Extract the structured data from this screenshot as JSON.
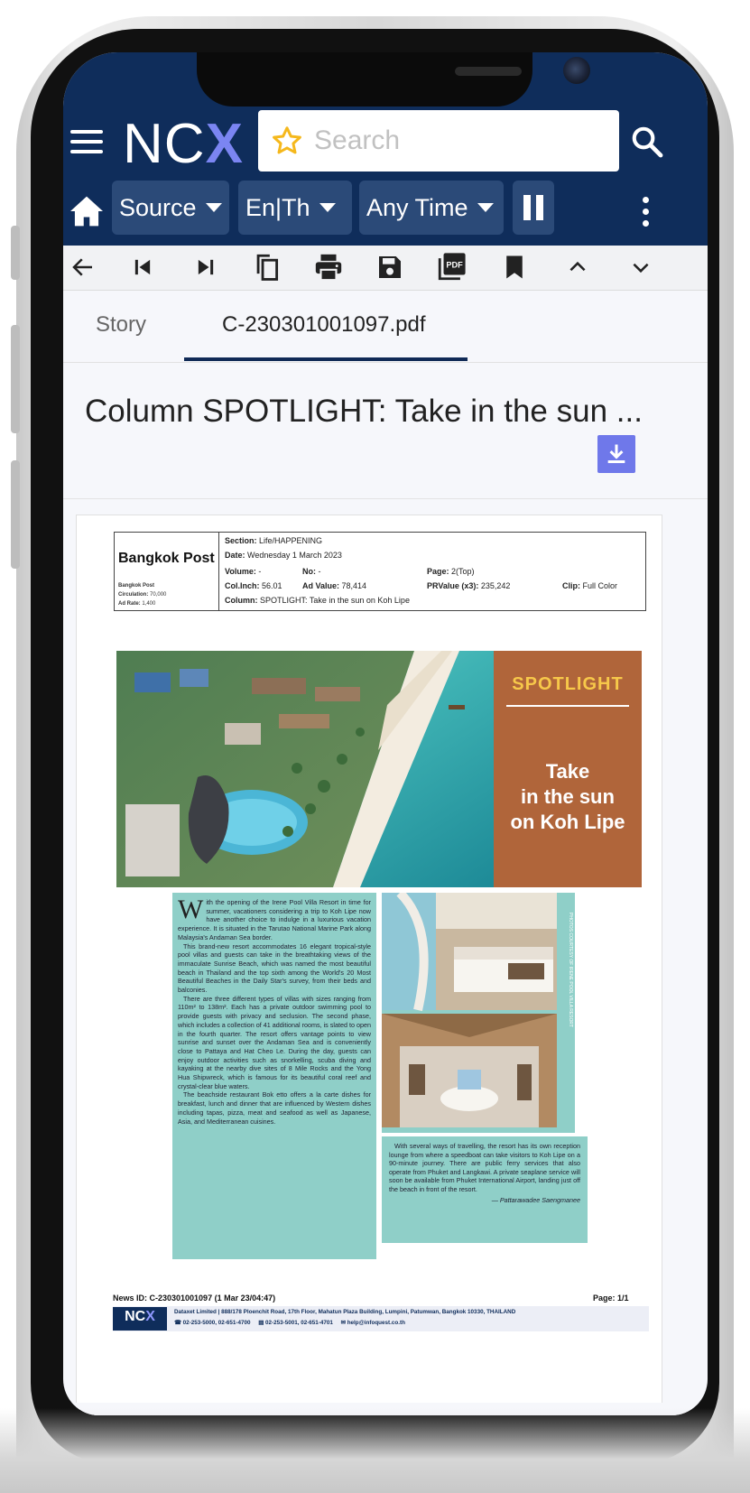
{
  "header": {
    "logo_main": "NC",
    "logo_x": "X",
    "search_placeholder": "Search"
  },
  "filters": {
    "source_label": "Source",
    "language_label": "En|Th",
    "time_label": "Any Time"
  },
  "toolbar": {
    "icons": [
      "back-arrow-icon",
      "first-page-icon",
      "last-page-icon",
      "copy-icon",
      "print-icon",
      "save-icon",
      "pdf-icon",
      "bookmark-icon",
      "chevron-up-icon",
      "chevron-down-icon"
    ],
    "pdf_text": "PDF"
  },
  "tabs": [
    {
      "label": "Story",
      "active": false
    },
    {
      "label": "C-230301001097.pdf",
      "active": true
    }
  ],
  "document": {
    "title": "Column SPOTLIGHT: Take in the sun ..."
  },
  "clipping": {
    "paper": "Bangkok Post",
    "paper_small": "Bangkok Post",
    "circulation_label": "Circulation:",
    "circulation": "70,000",
    "ad_rate_label": "Ad Rate:",
    "ad_rate": "1,400",
    "section_label": "Section:",
    "section": "Life/HAPPENING",
    "date_label": "Date:",
    "date": "Wednesday 1 March 2023",
    "volume_label": "Volume:",
    "volume": "-",
    "no_label": "No:",
    "no": "-",
    "page_label": "Page:",
    "page": "2(Top)",
    "colinch_label": "Col.Inch:",
    "colinch": "56.01",
    "ad_value_label": "Ad Value:",
    "ad_value": "78,414",
    "prvalue_label": "PRValue (x3):",
    "prvalue": "235,242",
    "clip_label": "Clip:",
    "clip": "Full Color",
    "column_label": "Column:",
    "column": "SPOTLIGHT: Take in the sun on Koh Lipe"
  },
  "article": {
    "kicker": "SPOTLIGHT",
    "headline_line1": "Take",
    "headline_line2": "in the sun",
    "headline_line3": "on Koh Lipe",
    "dropcap": "W",
    "para1": "ith the opening of the Irene Pool Villa Resort in time for summer, vacationers considering a trip to Koh Lipe now have another choice to indulge in a luxurious vacation experience. It is situated in the Tarutao National Marine Park along Malaysia's Andaman Sea border.",
    "para2": "This brand-new resort accommodates 16 elegant tropical-style pool villas and guests can take in the breathtaking views of the immaculate Sunrise Beach, which was named the most beautiful beach in Thailand and the top sixth among the World's 20 Most Beautiful Beaches in the Daily Star's survey, from their beds and balconies.",
    "para3": "There are three different types of villas with sizes ranging from 110m² to 138m². Each has a private outdoor swimming pool to provide guests with privacy and seclusion. The second phase, which includes a collection of 41 additional rooms, is slated to open in the fourth quarter. The resort offers vantage points to view sunrise and sunset over the Andaman Sea and is conveniently close to Pattaya and Hat Cheo Le. During the day, guests can enjoy outdoor activities such as snorkelling, scuba diving and kayaking at the nearby dive sites of 8 Mile Rocks and the Yong Hua Shipwreck, which is famous for its beautiful coral reef and crystal-clear blue waters.",
    "para4": "The beachside restaurant Bok etto offers a la carte dishes for breakfast, lunch and dinner that are influenced by Western dishes including tapas, pizza, meat and seafood as well as Japanese, Asia, and Mediterranean cuisines.",
    "sidebar": "With several ways of travelling, the resort has its own reception lounge from where a speedboat can take visitors to Koh Lipe on a 90-minute journey. There are public ferry services that also operate from Phuket and Langkawi. A private seaplane service will soon be available from Phuket International Airport, landing just off the beach in front of the resort.",
    "byline": "— Pattarawadee Saengmanee",
    "photo_credit": "PHOTOS COURTESY OF IRENE POOL VILLA RESORT"
  },
  "footer": {
    "news_id": "News ID: C-230301001097 (1 Mar 23/04:47)",
    "page": "Page: 1/1",
    "company_address": "Dataxet Limited | 888/178 Ploenchit Road, 17th Floor, Mahatun Plaza Building, Lumpini, Patumwan, Bangkok 10330, THAILAND",
    "phone": "02-253-5000, 02-651-4700",
    "fax": "02-253-5001, 02-651-4701",
    "email": "help@infoquest.co.th",
    "logo_main": "NC",
    "logo_x": "X"
  },
  "colors": {
    "header_bg": "#0f2d5b",
    "chip_bg": "#2b4a78",
    "accent": "#6f78ea",
    "teal_panel": "#8fcfc8",
    "spotlight_panel": "#b0653a",
    "star": "#f5b81c"
  }
}
